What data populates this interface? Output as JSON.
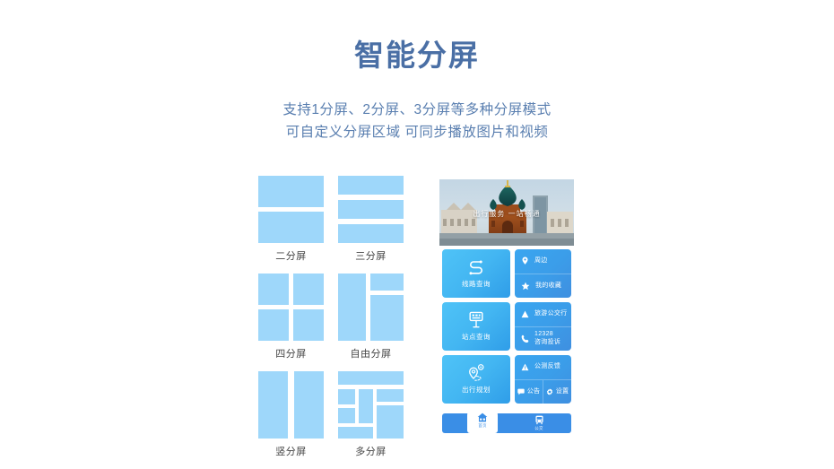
{
  "header": {
    "title": "智能分屏",
    "subtitle_line1": "支持1分屏、2分屏、3分屏等多种分屏模式",
    "subtitle_line2": "可自定义分屏区域  可同步播放图片和视频"
  },
  "split_modes": [
    {
      "id": "two-split",
      "caption": "二分屏",
      "blocks": 2
    },
    {
      "id": "three-split",
      "caption": "三分屏",
      "blocks": 3
    },
    {
      "id": "four-split",
      "caption": "四分屏",
      "blocks": 4
    },
    {
      "id": "free-split",
      "caption": "自由分屏",
      "blocks": 3
    },
    {
      "id": "vertical-split",
      "caption": "竖分屏",
      "blocks": 2
    },
    {
      "id": "multi-split",
      "caption": "多分屏",
      "blocks": 7
    }
  ],
  "phone": {
    "banner": {
      "overlay_text": "出行服务 一站畅通",
      "image_subject": "saint-sophia-cathedral-photo"
    },
    "tiles": [
      {
        "left": {
          "label": "线路查询",
          "icon": "route-s-icon"
        },
        "right": [
          {
            "label": "周边",
            "icon": "location-pin-icon"
          },
          {
            "label": "我的收藏",
            "icon": "star-icon"
          }
        ]
      },
      {
        "left": {
          "label": "站点查询",
          "icon": "bus-stop-sign-icon"
        },
        "right": [
          {
            "label": "旅游公交行",
            "icon": "mountain-icon"
          },
          {
            "label": "咨询投诉",
            "number": "12328",
            "icon": "phone-icon"
          }
        ]
      },
      {
        "left": {
          "label": "出行规划",
          "icon": "route-pins-icon"
        },
        "right": [
          {
            "label": "公测反馈",
            "icon": "warning-triangle-icon"
          }
        ],
        "right_pair": [
          {
            "label": "公告",
            "icon": "message-bubble-icon"
          },
          {
            "label": "设置",
            "icon": "gear-icon"
          }
        ]
      }
    ],
    "navbar": [
      {
        "label": "首页",
        "icon": "home-icon",
        "active": true
      },
      {
        "label": "公交",
        "icon": "bus-icon",
        "active": false
      }
    ]
  },
  "colors": {
    "title": "#4a6fa5",
    "subtitle": "#5a7fb0",
    "block": "#9ED7FA",
    "caption": "#444444",
    "tile_left": "#43b6f2",
    "tile_right": "#3b9de9",
    "navbar": "#3a8ee6"
  }
}
